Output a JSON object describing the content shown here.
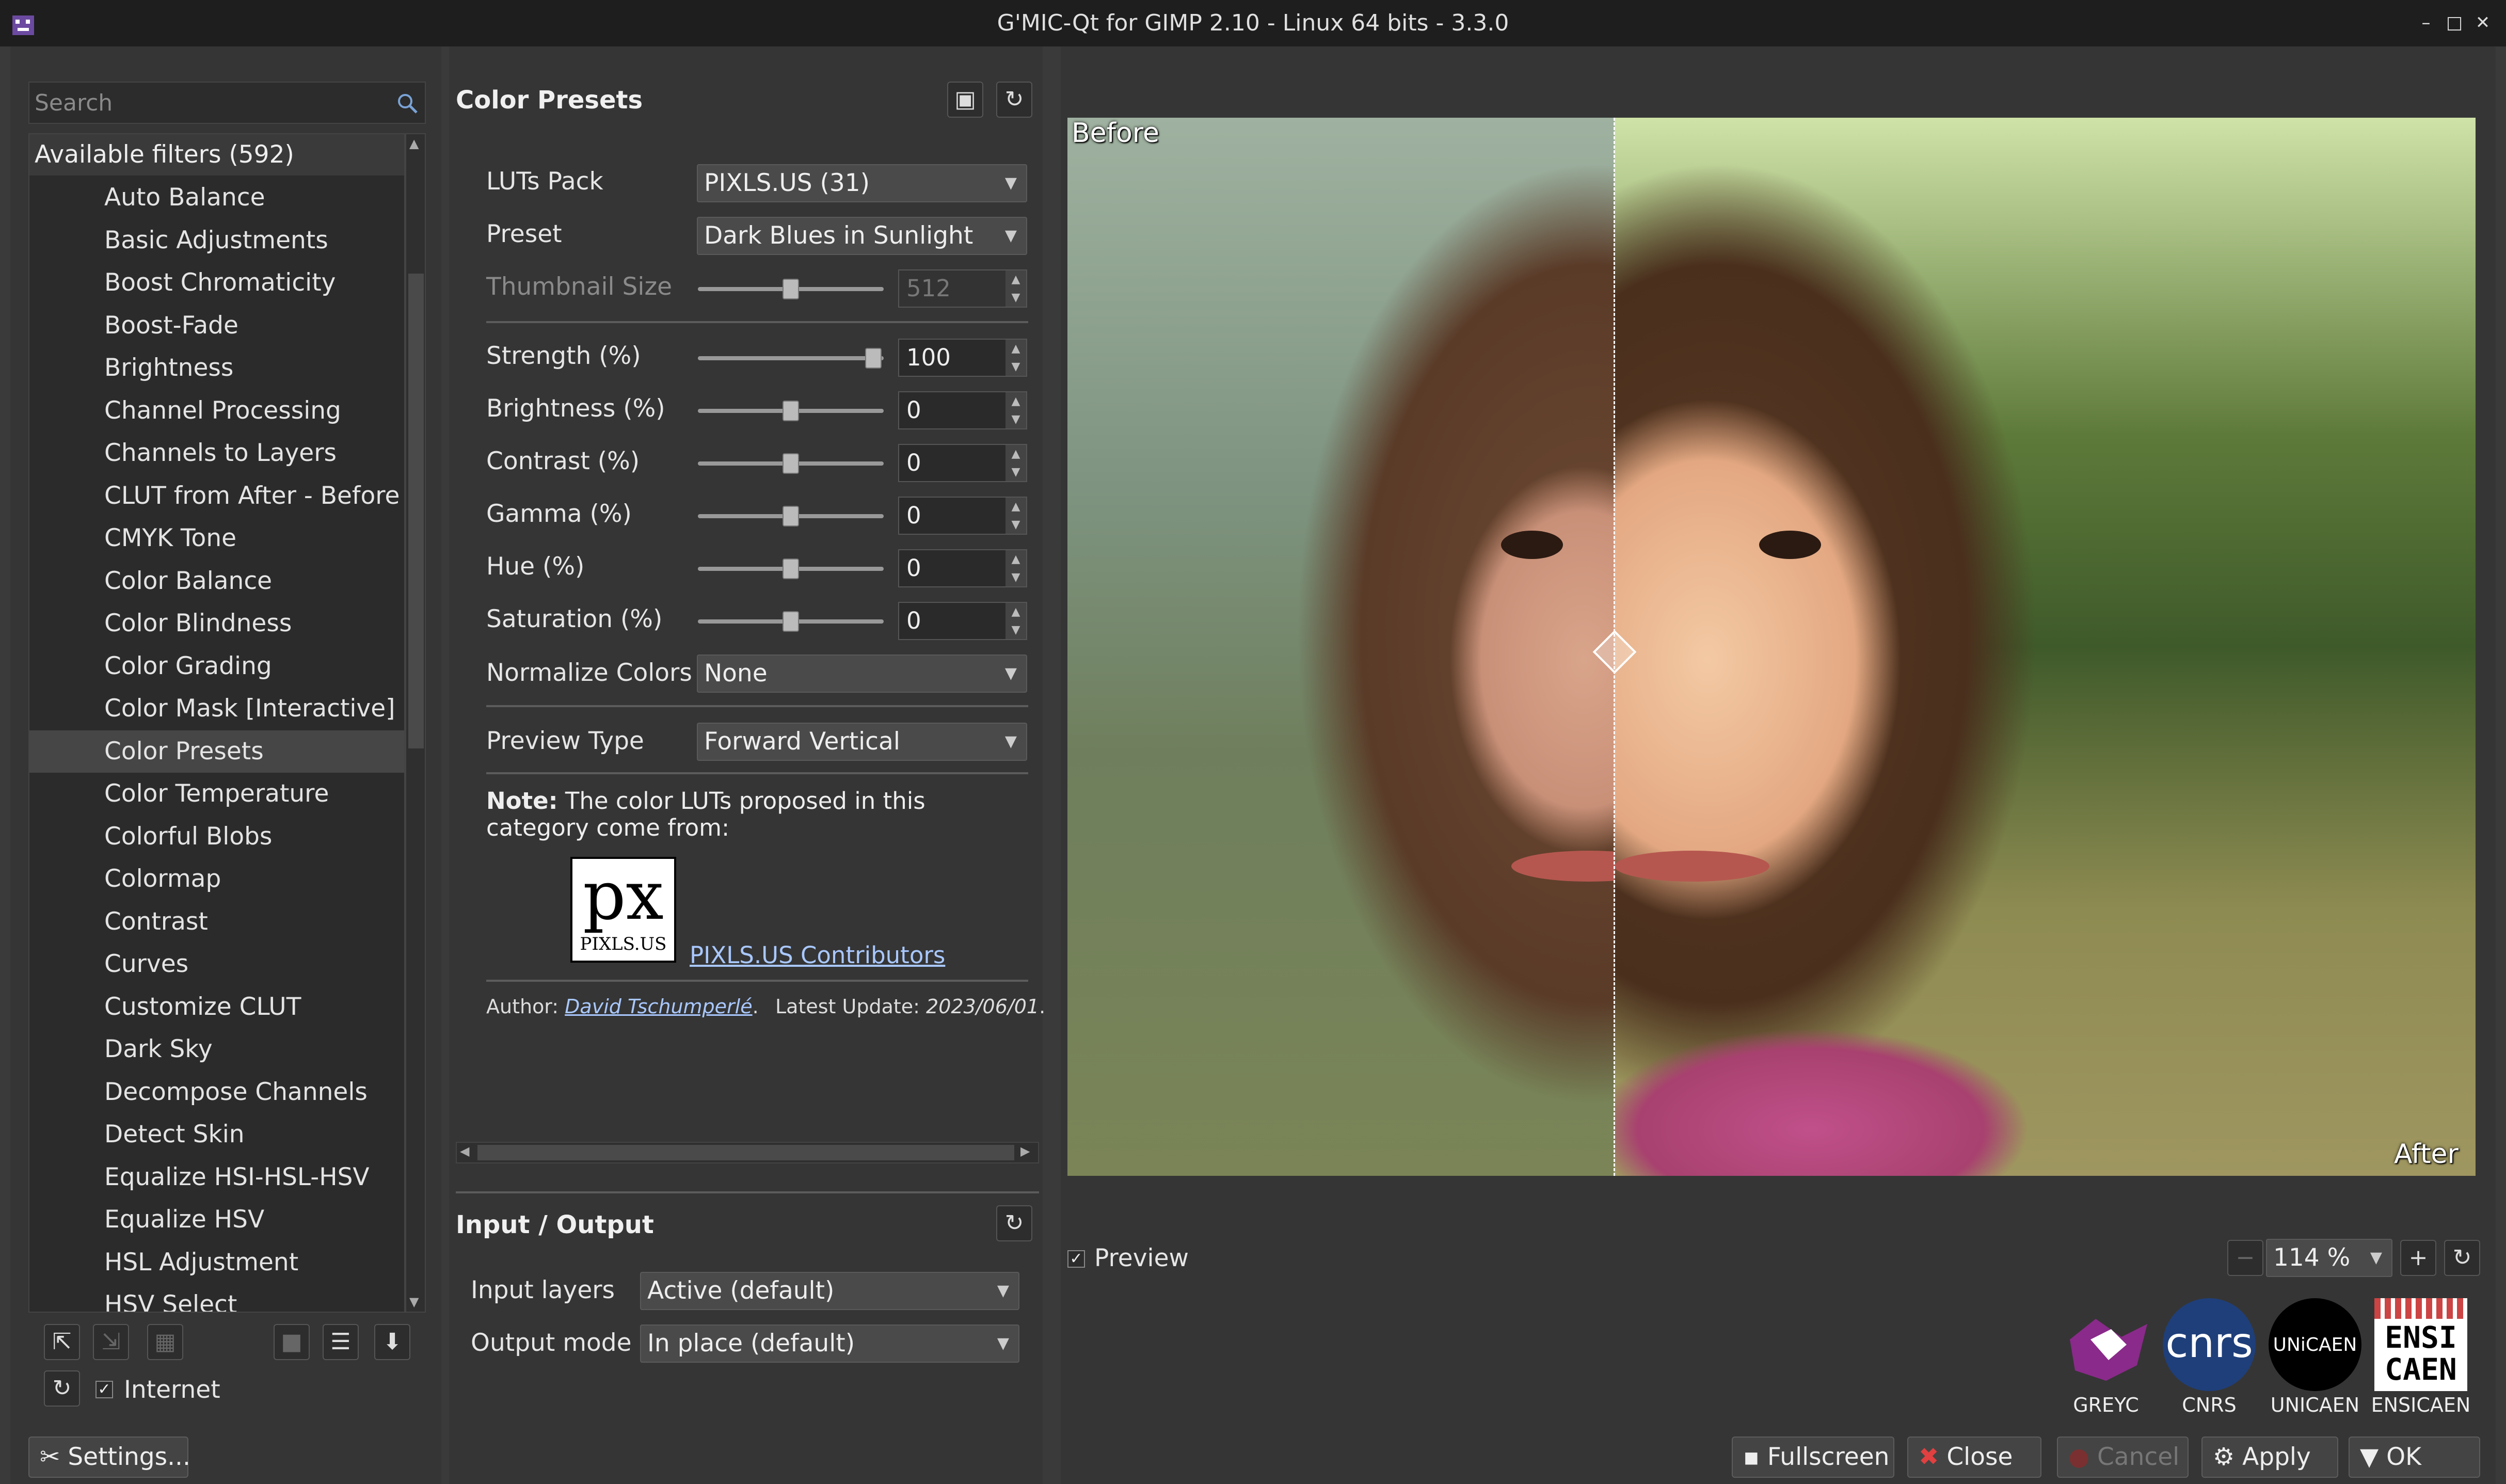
{
  "window": {
    "title": "G'MIC-Qt for GIMP 2.10 - Linux 64 bits - 3.3.0",
    "controls": [
      "–",
      "□",
      "✕"
    ]
  },
  "search": {
    "placeholder": "Search"
  },
  "filters": {
    "header": "Available filters (592)",
    "items": [
      "Auto Balance",
      "Basic Adjustments",
      "Boost Chromaticity",
      "Boost-Fade",
      "Brightness",
      "Channel Processing",
      "Channels to Layers",
      "CLUT from After - Before L",
      "CMYK Tone",
      "Color Balance",
      "Color Blindness",
      "Color Grading",
      "Color Mask [Interactive]",
      "Color Presets",
      "Color Temperature",
      "Colorful Blobs",
      "Colormap",
      "Contrast",
      "Curves",
      "Customize CLUT",
      "Dark Sky",
      "Decompose Channels",
      "Detect Skin",
      "Equalize HSI-HSL-HSV",
      "Equalize HSV",
      "HSL Adjustment",
      "HSV Select"
    ],
    "selected": "Color Presets"
  },
  "internet": {
    "label": "Internet",
    "checked": true
  },
  "settings_button": "Settings...",
  "filter_panel": {
    "title": "Color Presets",
    "luts_pack": {
      "label": "LUTs Pack",
      "value": "PIXLS.US (31)"
    },
    "preset": {
      "label": "Preset",
      "value": "Dark Blues in Sunlight"
    },
    "thumbnail_size": {
      "label": "Thumbnail Size",
      "value": "512",
      "level": 0.5
    },
    "strength": {
      "label": "Strength (%)",
      "value": "100",
      "level": 1.0
    },
    "brightness": {
      "label": "Brightness (%)",
      "value": "0",
      "level": 0.5
    },
    "contrast": {
      "label": "Contrast (%)",
      "value": "0",
      "level": 0.5
    },
    "gamma": {
      "label": "Gamma (%)",
      "value": "0",
      "level": 0.5
    },
    "hue": {
      "label": "Hue (%)",
      "value": "0",
      "level": 0.5
    },
    "saturation": {
      "label": "Saturation (%)",
      "value": "0",
      "level": 0.5
    },
    "normalize_colors": {
      "label": "Normalize Colors",
      "value": "None"
    },
    "preview_type": {
      "label": "Preview Type",
      "value": "Forward Vertical"
    },
    "note_bold": "Note:",
    "note_text": "The color LUTs proposed in this category come from:",
    "pixls_logo_big": "px",
    "pixls_logo_small": "PIXLS.US",
    "pixls_link": "PIXLS.US Contributors",
    "author_label": "Author:",
    "author_name": "David Tschumperlé",
    "update_label": "Latest Update:",
    "update_value": "2023/06/01"
  },
  "io_panel": {
    "title": "Input / Output",
    "input_layers": {
      "label": "Input layers",
      "value": "Active (default)"
    },
    "output_mode": {
      "label": "Output mode",
      "value": "In place (default)"
    }
  },
  "preview": {
    "before_label": "Before",
    "after_label": "After",
    "checkbox_label": "Preview",
    "checked": true,
    "zoom": "114 %"
  },
  "logos": [
    "GREYC",
    "CNRS",
    "UNICAEN",
    "ENSICAEN"
  ],
  "logo_marks": {
    "cnrs": "cnrs",
    "unicaen": "UNiCAEN",
    "ensi_line1": "ENSI",
    "ensi_line2": "CAEN"
  },
  "buttons": {
    "fullscreen": "Fullscreen",
    "close": "Close",
    "cancel": "Cancel",
    "apply": "Apply",
    "ok": "OK"
  },
  "colors": {
    "accent_link": "#a9c8ff",
    "panel_bg": "#353535",
    "list_bg": "#2b2b2b"
  }
}
